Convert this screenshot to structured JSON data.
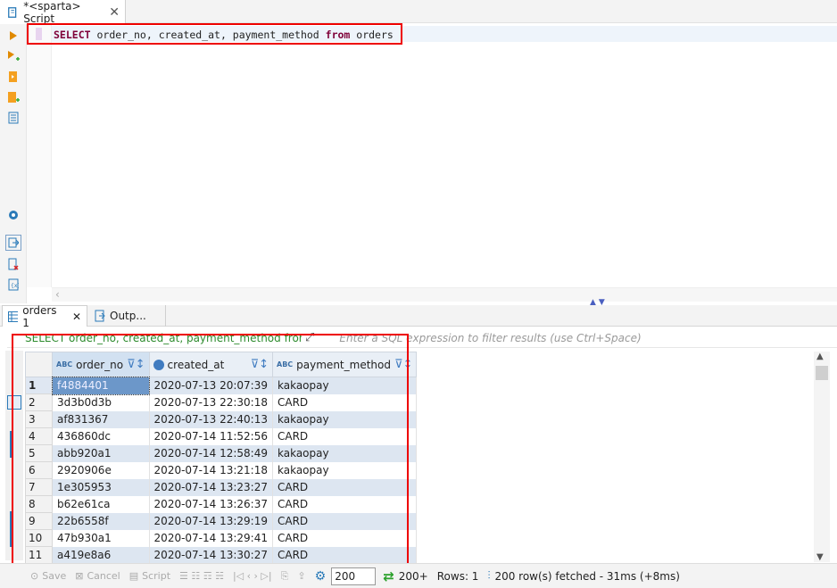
{
  "editor": {
    "tab_title": "*<sparta> Script",
    "sql": {
      "select": "SELECT",
      "columns": " order_no, created_at, payment_method ",
      "from": "from",
      "table": " orders"
    }
  },
  "results": {
    "tabs": [
      "orders 1",
      "Outp..."
    ],
    "filter_sql": "SELECT order_no, created_at, payment_method from orde",
    "filter_placeholder": "Enter a SQL expression to filter results (use Ctrl+Space)",
    "columns": [
      {
        "name": "order_no",
        "type": "ABC"
      },
      {
        "name": "created_at",
        "type": "clock"
      },
      {
        "name": "payment_method",
        "type": "ABC"
      }
    ],
    "rows": [
      [
        "1",
        "f4884401",
        "2020-07-13 20:07:39",
        "kakaopay"
      ],
      [
        "2",
        "3d3b0d3b",
        "2020-07-13 22:30:18",
        "CARD"
      ],
      [
        "3",
        "af831367",
        "2020-07-13 22:40:13",
        "kakaopay"
      ],
      [
        "4",
        "436860dc",
        "2020-07-14 11:52:56",
        "CARD"
      ],
      [
        "5",
        "abb920a1",
        "2020-07-14 12:58:49",
        "kakaopay"
      ],
      [
        "6",
        "2920906e",
        "2020-07-14 13:21:18",
        "kakaopay"
      ],
      [
        "7",
        "1e305953",
        "2020-07-14 13:23:27",
        "CARD"
      ],
      [
        "8",
        "b62e61ca",
        "2020-07-14 13:26:37",
        "CARD"
      ],
      [
        "9",
        "22b6558f",
        "2020-07-14 13:29:19",
        "CARD"
      ],
      [
        "10",
        "47b930a1",
        "2020-07-14 13:29:41",
        "CARD"
      ],
      [
        "11",
        "a419e8a6",
        "2020-07-14 13:30:27",
        "CARD"
      ]
    ]
  },
  "toolbar": {
    "save": "Save",
    "cancel": "Cancel",
    "script": "Script",
    "limit": "200",
    "fetch_more": "200+",
    "rows": "Rows: 1",
    "status": "200 row(s) fetched - 31ms (+8ms)"
  }
}
